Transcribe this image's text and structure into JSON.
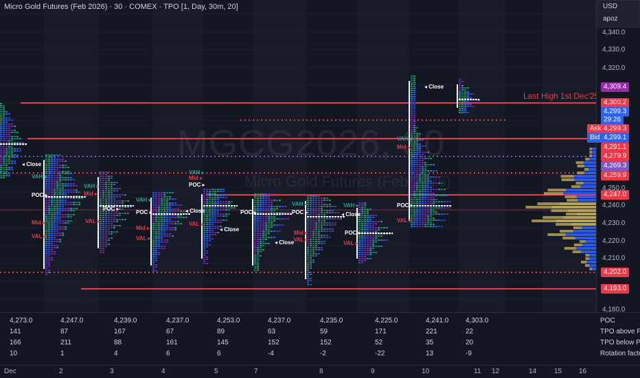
{
  "title": "Micro Gold Futures (Feb 2026) · 30 · COMEX · TPO [1, Day, 30m, 20]",
  "watermark": {
    "symbol": "MGCG2026, 30",
    "name": "Micro Gold Futures (Feb 2026)"
  },
  "currency_menu": {
    "currency": "USD",
    "unit": "apoz"
  },
  "price_axis": [
    "4,340.0",
    "4,330.0",
    "4,320.0",
    "4,250.0",
    "4,240.0",
    "4,230.0",
    "4,220.0",
    "4,210.0",
    "4,180.0"
  ],
  "price_tags": [
    {
      "value": "4,309.4",
      "color": "#9c27b0"
    },
    {
      "value": "4,300.2",
      "color": "#f23645"
    },
    {
      "value": "4,299.3",
      "color": "#2962ff"
    },
    {
      "value": "29:26",
      "color": "#2962ff"
    },
    {
      "value": "Ask",
      "color": "#f23645"
    },
    {
      "value": "4,299.3",
      "color": "#f23645"
    },
    {
      "value": "Bid",
      "color": "#2962ff"
    },
    {
      "value": "4,299.1",
      "color": "#2962ff"
    },
    {
      "value": "4,291.1",
      "color": "#f23645"
    },
    {
      "value": "4,279.9",
      "color": "#f23645"
    },
    {
      "value": "4,269.3",
      "color": "#7e57c2"
    },
    {
      "value": "4,259.9",
      "color": "#f23645"
    },
    {
      "value": "4,247.0",
      "color": "#f23645"
    },
    {
      "value": "4,202.0",
      "color": "#f23645"
    },
    {
      "value": "4,193.0",
      "color": "#f23645"
    }
  ],
  "annotation": "Last High 1st Dec'25",
  "profile_labels": {
    "close": "Close",
    "vah": "VAH",
    "mid": "Mid",
    "poc": "POC",
    "val": "VAL"
  },
  "stats": {
    "row_labels": [
      "POC",
      "TPO above POC",
      "TPO below POC",
      "Rotation factor"
    ],
    "columns": [
      {
        "poc": "4,273.0",
        "above": "141",
        "below": "166",
        "rot": "10"
      },
      {
        "poc": "4,247.0",
        "above": "87",
        "below": "211",
        "rot": "1"
      },
      {
        "poc": "4,239.0",
        "above": "167",
        "below": "88",
        "rot": "4"
      },
      {
        "poc": "4,237.0",
        "above": "67",
        "below": "161",
        "rot": "6"
      },
      {
        "poc": "4,253.0",
        "above": "89",
        "below": "145",
        "rot": "6"
      },
      {
        "poc": "4,237.0",
        "above": "63",
        "below": "152",
        "rot": "-4"
      },
      {
        "poc": "4,235.0",
        "above": "59",
        "below": "152",
        "rot": "-2"
      },
      {
        "poc": "4,225.0",
        "above": "171",
        "below": "52",
        "rot": "-22"
      },
      {
        "poc": "4,241.0",
        "above": "221",
        "below": "35",
        "rot": "13"
      },
      {
        "poc": "4,303.0",
        "above": "22",
        "below": "20",
        "rot": "-9"
      }
    ]
  },
  "time_axis": [
    "Dec",
    "2",
    "3",
    "4",
    "5",
    "7",
    "8",
    "9",
    "10",
    "11",
    "12",
    "14",
    "15",
    "16"
  ],
  "colors": {
    "background": "#131722",
    "red": "#f23645",
    "blue": "#2962ff",
    "purple": "#7e57c2",
    "gold": "#c9b458"
  }
}
